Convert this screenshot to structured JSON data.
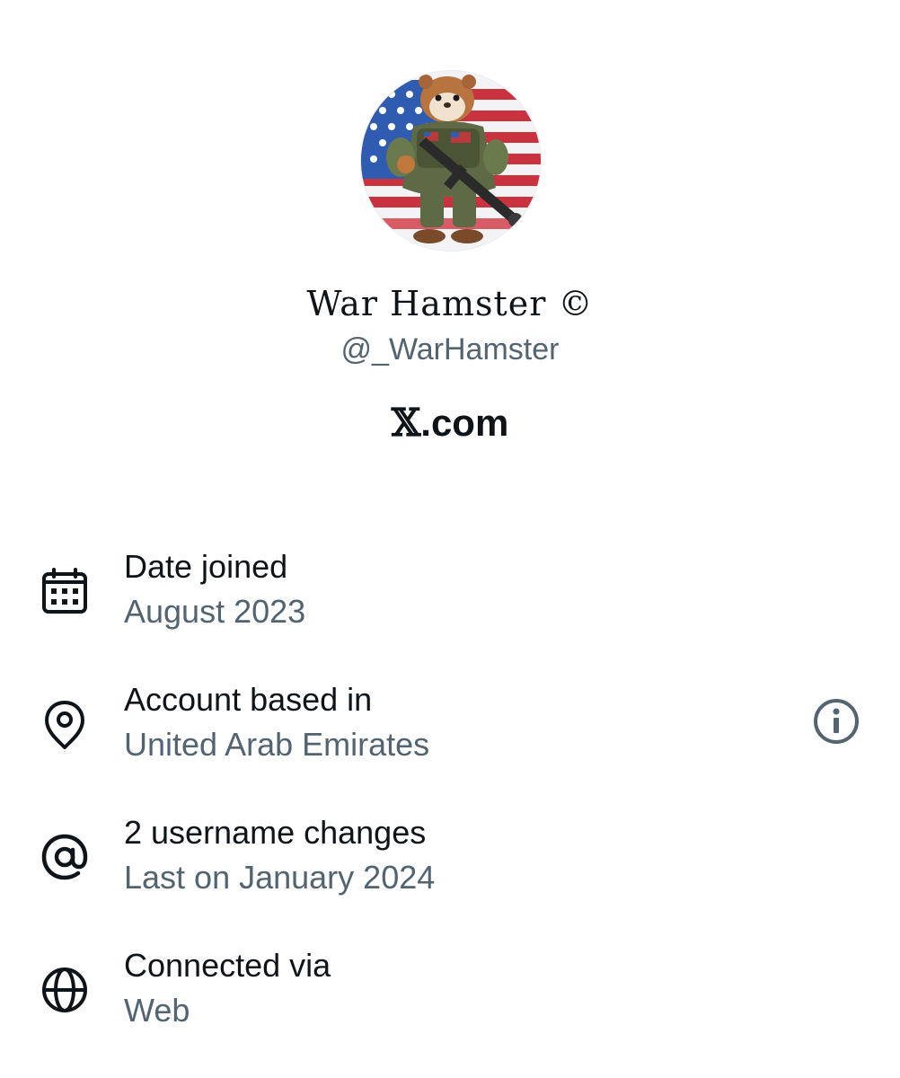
{
  "profile": {
    "display_name": "War Hamster ©",
    "handle": "@_WarHamster",
    "site": "X.com",
    "site_x": "𝕏",
    "site_rest": ".com"
  },
  "details": [
    {
      "icon": "calendar-icon",
      "label": "Date joined",
      "value": "August 2023"
    },
    {
      "icon": "location-pin-icon",
      "label": "Account based in",
      "value": "United Arab Emirates"
    },
    {
      "icon": "at-sign-icon",
      "label": "2 username changes",
      "value": "Last on January 2024"
    },
    {
      "icon": "globe-icon",
      "label": "Connected via",
      "value": "Web"
    }
  ],
  "colors": {
    "primary_text": "#0f1419",
    "secondary_text": "#536471",
    "background": "#ffffff"
  }
}
